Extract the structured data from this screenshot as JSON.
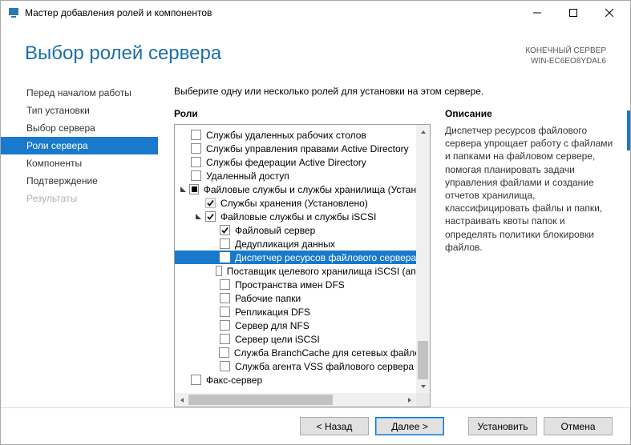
{
  "window": {
    "title": "Мастер добавления ролей и компонентов"
  },
  "header": {
    "title": "Выбор ролей сервера",
    "meta1": "КОНЕЧНЫЙ СЕРВЕР",
    "meta2": "WIN-EC6EO8YDAL6"
  },
  "sidebar": {
    "items": [
      {
        "label": "Перед началом работы",
        "state": ""
      },
      {
        "label": "Тип установки",
        "state": ""
      },
      {
        "label": "Выбор сервера",
        "state": ""
      },
      {
        "label": "Роли сервера",
        "state": "active"
      },
      {
        "label": "Компоненты",
        "state": ""
      },
      {
        "label": "Подтверждение",
        "state": ""
      },
      {
        "label": "Результаты",
        "state": "disabled"
      }
    ]
  },
  "main": {
    "intro": "Выберите одну или несколько ролей для установки на этом сервере.",
    "roles_title": "Роли",
    "desc_title": "Описание",
    "desc_text": "Диспетчер ресурсов файлового сервера упрощает работу с файлами и папками на файловом сервере, помогая планировать задачи управления файлами и создание отчетов хранилища, классифицировать файлы и папки, настраивать квоты папок и определять политики блокировки файлов."
  },
  "tree": [
    {
      "indent": 0,
      "exp": "",
      "cb": "empty",
      "label": "Службы удаленных рабочих столов"
    },
    {
      "indent": 0,
      "exp": "",
      "cb": "empty",
      "label": "Службы управления правами Active Directory"
    },
    {
      "indent": 0,
      "exp": "",
      "cb": "empty",
      "label": "Службы федерации Active Directory"
    },
    {
      "indent": 0,
      "exp": "",
      "cb": "empty",
      "label": "Удаленный доступ"
    },
    {
      "indent": 0,
      "exp": "open",
      "cb": "square",
      "label": "Файловые службы и службы хранилища (Установлено)"
    },
    {
      "indent": 1,
      "exp": "",
      "cb": "checked-disabled",
      "label": "Службы хранения (Установлено)"
    },
    {
      "indent": 1,
      "exp": "open",
      "cb": "checked",
      "label": "Файловые службы и службы iSCSI"
    },
    {
      "indent": 2,
      "exp": "",
      "cb": "checked",
      "label": "Файловый сервер"
    },
    {
      "indent": 2,
      "exp": "",
      "cb": "empty",
      "label": "Дедупликация данных"
    },
    {
      "indent": 2,
      "exp": "",
      "cb": "empty",
      "label": "Диспетчер ресурсов файлового сервера",
      "sel": true
    },
    {
      "indent": 2,
      "exp": "",
      "cb": "empty",
      "label": "Поставщик целевого хранилища iSCSI (аппаратные поставщики VDS и VSS)"
    },
    {
      "indent": 2,
      "exp": "",
      "cb": "empty",
      "label": "Пространства имен DFS"
    },
    {
      "indent": 2,
      "exp": "",
      "cb": "empty",
      "label": "Рабочие папки"
    },
    {
      "indent": 2,
      "exp": "",
      "cb": "empty",
      "label": "Репликация DFS"
    },
    {
      "indent": 2,
      "exp": "",
      "cb": "empty",
      "label": "Сервер для NFS"
    },
    {
      "indent": 2,
      "exp": "",
      "cb": "empty",
      "label": "Сервер цели iSCSI"
    },
    {
      "indent": 2,
      "exp": "",
      "cb": "empty",
      "label": "Служба BranchCache для сетевых файлов"
    },
    {
      "indent": 2,
      "exp": "",
      "cb": "empty",
      "label": "Служба агента VSS файлового сервера"
    },
    {
      "indent": 0,
      "exp": "",
      "cb": "empty",
      "label": "Факс-сервер"
    }
  ],
  "footer": {
    "back": "< Назад",
    "next": "Далее >",
    "install": "Установить",
    "cancel": "Отмена"
  }
}
